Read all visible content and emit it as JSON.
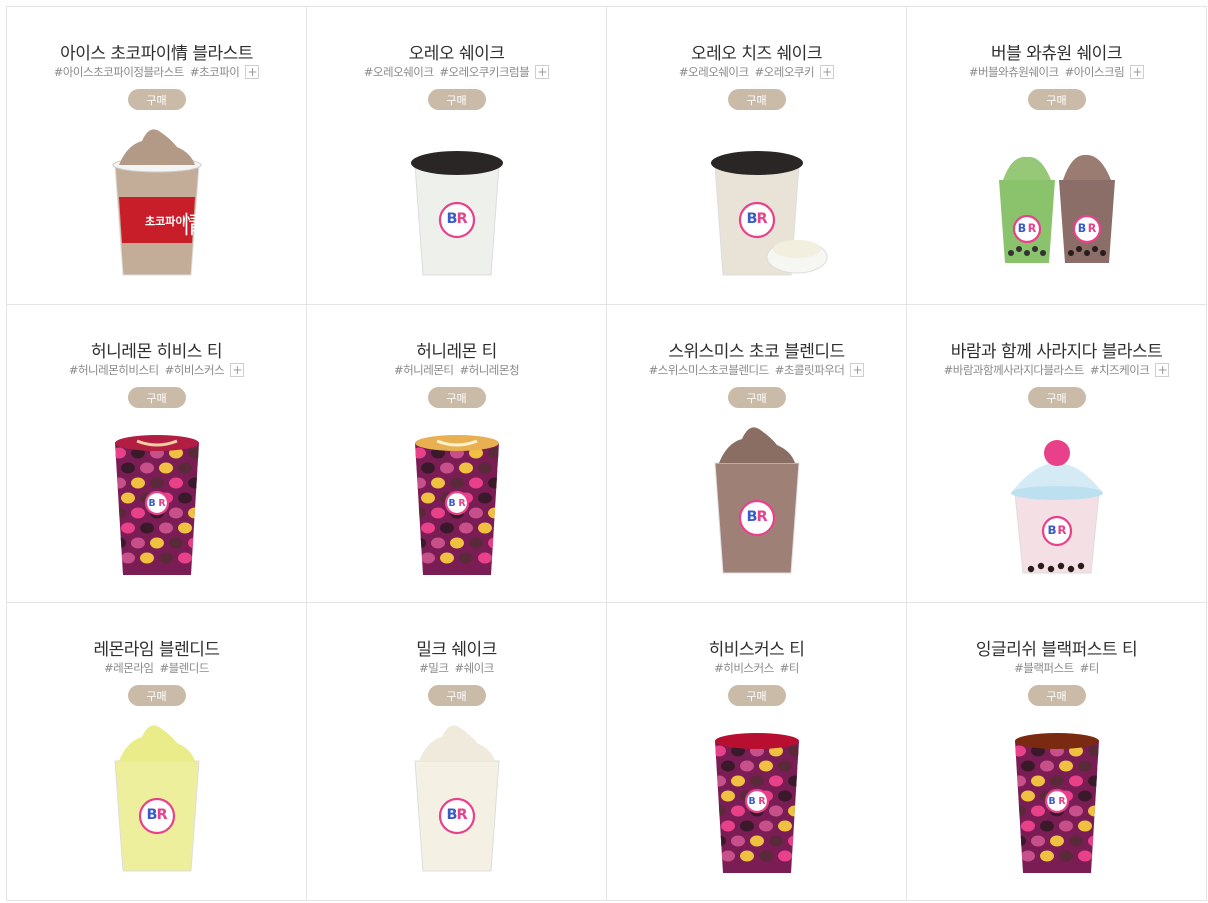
{
  "plus_label": "+",
  "products": [
    {
      "name": "아이스 초코파이情 블라스트",
      "tags": [
        "#아이스초코파이정블라스트",
        "#초코파이"
      ],
      "has_more": true,
      "buy_label": "구매",
      "cup": "blast-chocopie"
    },
    {
      "name": "오레오 쉐이크",
      "tags": [
        "#오레오쉐이크",
        "#오레오쿠키크럼블"
      ],
      "has_more": true,
      "buy_label": "구매",
      "cup": "oreo-shake"
    },
    {
      "name": "오레오 치즈 쉐이크",
      "tags": [
        "#오레오쉐이크",
        "#오레오쿠키"
      ],
      "has_more": true,
      "buy_label": "구매",
      "cup": "oreo-cheese-shake"
    },
    {
      "name": "버블 와츄원 쉐이크",
      "tags": [
        "#버블와츄원쉐이크",
        "#아이스크림"
      ],
      "has_more": true,
      "buy_label": "구매",
      "cup": "bubble-shake"
    },
    {
      "name": "허니레몬 히비스 티",
      "tags": [
        "#허니레몬히비스티",
        "#히비스커스"
      ],
      "has_more": true,
      "buy_label": "구매",
      "cup": "hot-red"
    },
    {
      "name": "허니레몬 티",
      "tags": [
        "#허니레몬티",
        "#허니레몬청"
      ],
      "has_more": false,
      "buy_label": "구매",
      "cup": "hot-yellow"
    },
    {
      "name": "스위스미스 초코 블렌디드",
      "tags": [
        "#스위스미스초코블렌디드",
        "#초콜릿파우더"
      ],
      "has_more": true,
      "buy_label": "구매",
      "cup": "choco-blended"
    },
    {
      "name": "바람과 함께 사라지다 블라스트",
      "tags": [
        "#바람과함께사라지다블라스트",
        "#치즈케이크"
      ],
      "has_more": true,
      "buy_label": "구매",
      "cup": "dome-blast"
    },
    {
      "name": "레몬라임 블렌디드",
      "tags": [
        "#레몬라임",
        "#블렌디드"
      ],
      "has_more": false,
      "buy_label": "구매",
      "cup": "lemon-blended"
    },
    {
      "name": "밀크 쉐이크",
      "tags": [
        "#밀크",
        "#쉐이크"
      ],
      "has_more": false,
      "buy_label": "구매",
      "cup": "milk-shake"
    },
    {
      "name": "히비스커스 티",
      "tags": [
        "#히비스커스",
        "#티"
      ],
      "has_more": false,
      "buy_label": "구매",
      "cup": "tea-red"
    },
    {
      "name": "잉글리쉬 블랙퍼스트 티",
      "tags": [
        "#블랙퍼스트",
        "#티"
      ],
      "has_more": false,
      "buy_label": "구매",
      "cup": "tea-brown"
    }
  ],
  "colors": {
    "buy_button": "#c9bba8",
    "border": "#e4e4e4",
    "title": "#2f2f2f",
    "tag": "#8a8a8a",
    "brand_pink": "#e8418a",
    "brand_blue": "#3b5cc6"
  }
}
